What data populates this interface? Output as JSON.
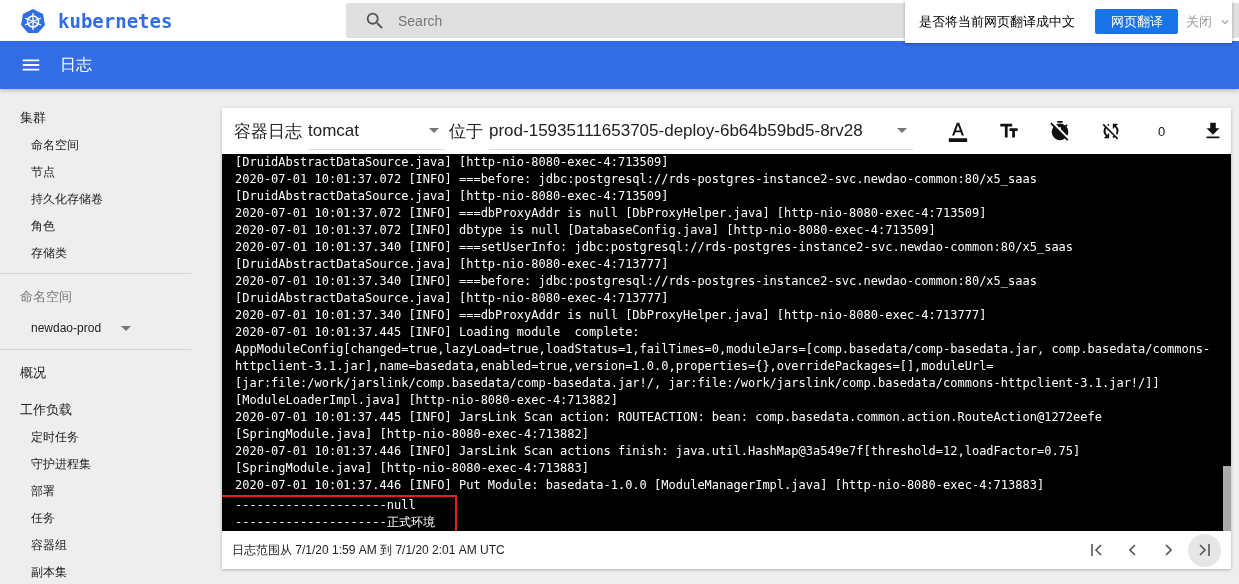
{
  "header": {
    "logo": "kubernetes",
    "search": {
      "placeholder": "Search"
    }
  },
  "translate_bar": {
    "prompt": "是否将当前网页翻译成中文",
    "translate_button": "网页翻译",
    "close": "关闭"
  },
  "toolbar": {
    "title": "日志"
  },
  "sidebar": {
    "sections": [
      {
        "kind": "group",
        "label": "集群",
        "children": [
          {
            "label": "命名空间"
          },
          {
            "label": "节点"
          },
          {
            "label": "持久化存储卷"
          },
          {
            "label": "角色"
          },
          {
            "label": "存储类"
          }
        ]
      },
      {
        "kind": "namespace",
        "label": "命名空间",
        "value": "newdao-prod"
      },
      {
        "kind": "link",
        "label": "概况"
      },
      {
        "kind": "group",
        "label": "工作负载",
        "children": [
          {
            "label": "定时任务"
          },
          {
            "label": "守护进程集"
          },
          {
            "label": "部署"
          },
          {
            "label": "任务"
          },
          {
            "label": "容器组"
          },
          {
            "label": "副本集"
          }
        ]
      }
    ]
  },
  "log_card": {
    "container_select": {
      "prefix": "容器日志",
      "value": "tomcat"
    },
    "pod_select": {
      "prefix": "位于",
      "value": "prod-15935111653705-deploy-6b64b59bd5-8rv28"
    },
    "actions": [
      {
        "kind": "text-color"
      },
      {
        "kind": "text-size"
      },
      {
        "kind": "timer-off"
      },
      {
        "kind": "sync-off"
      },
      {
        "kind": "count",
        "label": "0"
      },
      {
        "kind": "download"
      }
    ],
    "lines": [
      {
        "text": "[DruidAbstractDataSource.java] [http-nio-8080-exec-4:713509]"
      },
      {
        "text": "2020-07-01 10:01:37.072 [INFO] ===before: jdbc:postgresql://rds-postgres-instance2-svc.newdao-common:80/x5_saas"
      },
      {
        "text": "[DruidAbstractDataSource.java] [http-nio-8080-exec-4:713509]"
      },
      {
        "text": "2020-07-01 10:01:37.072 [INFO] ===dbProxyAddr is null [DbProxyHelper.java] [http-nio-8080-exec-4:713509]"
      },
      {
        "text": "2020-07-01 10:01:37.072 [INFO] dbtype is null [DatabaseConfig.java] [http-nio-8080-exec-4:713509]"
      },
      {
        "text": "2020-07-01 10:01:37.340 [INFO] ===setUserInfo: jdbc:postgresql://rds-postgres-instance2-svc.newdao-common:80/x5_saas"
      },
      {
        "text": "[DruidAbstractDataSource.java] [http-nio-8080-exec-4:713777]"
      },
      {
        "text": "2020-07-01 10:01:37.340 [INFO] ===before: jdbc:postgresql://rds-postgres-instance2-svc.newdao-common:80/x5_saas"
      },
      {
        "text": "[DruidAbstractDataSource.java] [http-nio-8080-exec-4:713777]"
      },
      {
        "text": "2020-07-01 10:01:37.340 [INFO] ===dbProxyAddr is null [DbProxyHelper.java] [http-nio-8080-exec-4:713777]"
      },
      {
        "text": "2020-07-01 10:01:37.445 [INFO] Loading module  complete:"
      },
      {
        "text": "AppModuleConfig[changed=true,lazyLoad=true,loadStatus=1,failTimes=0,moduleJars=[comp.basedata/comp-basedata.jar, comp.basedata/commons-"
      },
      {
        "text": "httpclient-3.1.jar],name=basedata,enabled=true,version=1.0.0,properties={},overridePackages=[],moduleUrl="
      },
      {
        "text": "[jar:file:/work/jarslink/comp.basedata/comp-basedata.jar!/, jar:file:/work/jarslink/comp.basedata/commons-httpclient-3.1.jar!/]]"
      },
      {
        "text": "[ModuleLoaderImpl.java] [http-nio-8080-exec-4:713882]"
      },
      {
        "text": "2020-07-01 10:01:37.445 [INFO] JarsLink Scan action: ROUTEACTION: bean: comp.basedata.common.action.RouteAction@1272eefe"
      },
      {
        "text": "[SpringModule.java] [http-nio-8080-exec-4:713882]"
      },
      {
        "text": "2020-07-01 10:01:37.446 [INFO] JarsLink Scan actions finish: java.util.HashMap@3a549e7f[threshold=12,loadFactor=0.75]"
      },
      {
        "text": "[SpringModule.java] [http-nio-8080-exec-4:713883]"
      },
      {
        "text": "2020-07-01 10:01:37.446 [INFO] Put Module: basedata-1.0.0 [ModuleManagerImpl.java] [http-nio-8080-exec-4:713883]"
      }
    ],
    "highlighted_lines": [
      "---------------------null",
      "---------------------正式环境"
    ],
    "range": "日志范围从 7/1/20 1:59 AM 到 7/1/20 2:01 AM UTC",
    "pager": [
      {
        "kind": "first",
        "selected": false
      },
      {
        "kind": "prev",
        "selected": false
      },
      {
        "kind": "next",
        "selected": false
      },
      {
        "kind": "last",
        "selected": true
      }
    ]
  }
}
